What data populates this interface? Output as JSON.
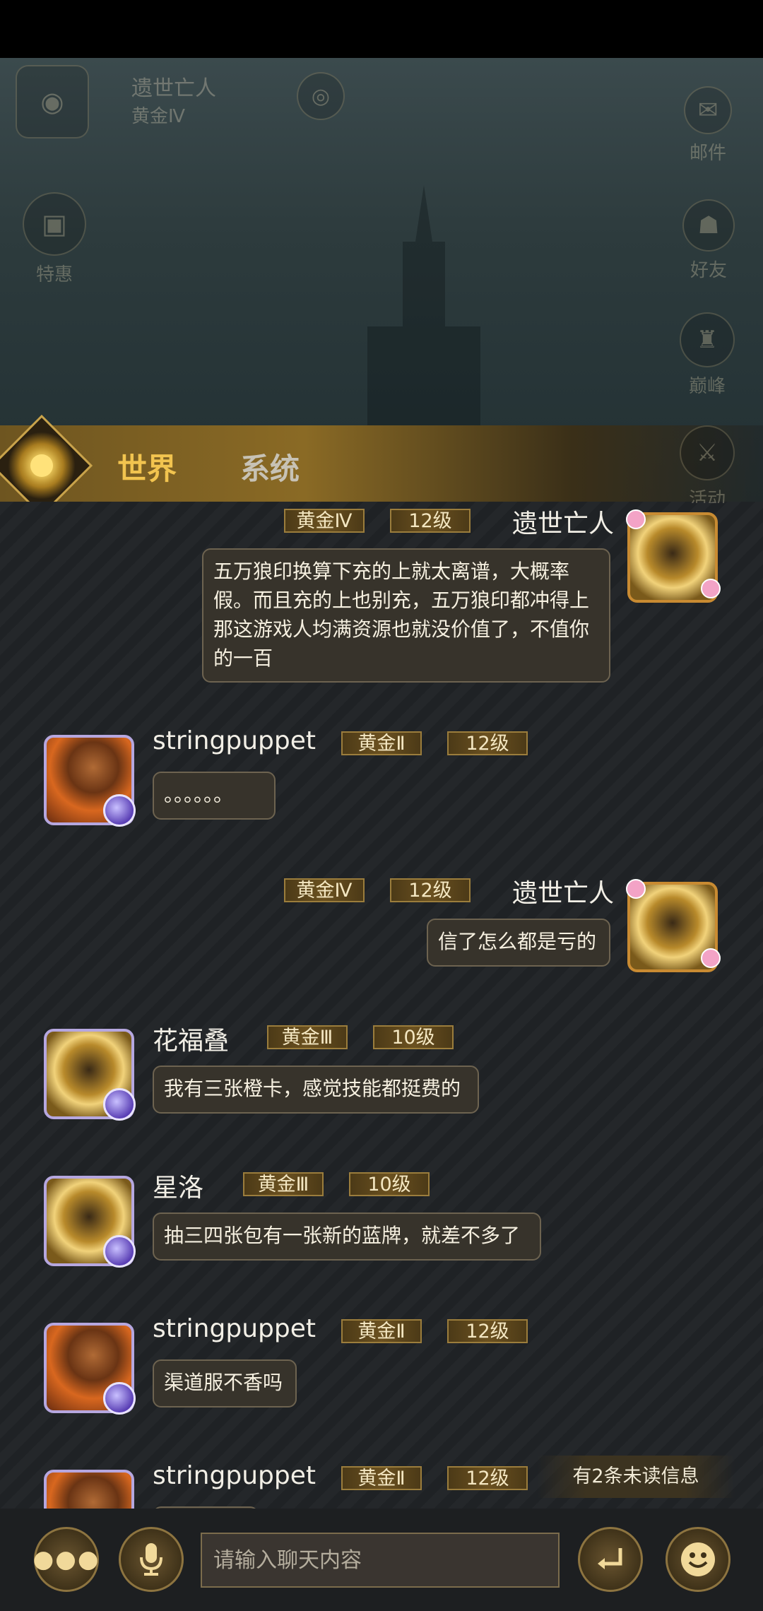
{
  "hud": {
    "player_name": "遗世亡人",
    "player_rank": "黄金Ⅳ",
    "mail_label": "邮件",
    "deals_label": "特惠",
    "friends_label": "好友",
    "peak_label": "巅峰",
    "events_label": "活动"
  },
  "tabs": {
    "world": "世界",
    "system": "系统"
  },
  "messages": [
    {
      "name": "遗世亡人",
      "rank": "黄金Ⅳ",
      "level": "12级",
      "text": "五万狼印换算下充的上就太离谱，大概率假。而且充的上也别充，五万狼印都冲得上那这游戏人均满资源也就没价值了，不值你的一百"
    },
    {
      "name": "stringpuppet",
      "rank": "黄金Ⅱ",
      "level": "12级",
      "text": "。。。。。。"
    },
    {
      "name": "遗世亡人",
      "rank": "黄金Ⅳ",
      "level": "12级",
      "text": "信了怎么都是亏的"
    },
    {
      "name": "花福叠",
      "rank": "黄金Ⅲ",
      "level": "10级",
      "text": "我有三张橙卡，感觉技能都挺费的"
    },
    {
      "name": "星洛",
      "rank": "黄金Ⅲ",
      "level": "10级",
      "text": "抽三四张包有一张新的蓝牌，就差不多了"
    },
    {
      "name": "stringpuppet",
      "rank": "黄金Ⅱ",
      "level": "12级",
      "text": "渠道服不香吗"
    },
    {
      "name": "stringpuppet",
      "rank": "黄金Ⅱ",
      "level": "12级",
      "text": ""
    }
  ],
  "unread_notice": "有2条未读信息",
  "input": {
    "placeholder": "请输入聊天内容"
  },
  "icons": {
    "more": "more-icon",
    "voice": "microphone-icon",
    "send": "send-icon",
    "emoji": "emoji-icon"
  }
}
